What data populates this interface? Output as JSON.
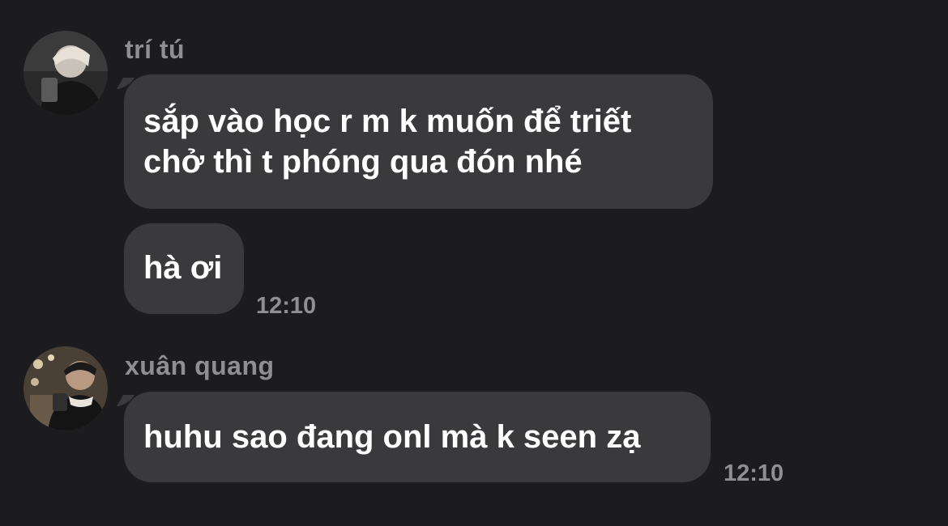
{
  "messages": [
    {
      "sender": "trí tú",
      "bubbles": [
        {
          "lines": [
            "sắp vào học r m k muốn để triết",
            "chở thì t phóng qua đón nhé"
          ]
        },
        {
          "lines": [
            "hà ơi"
          ],
          "time": "12:10"
        }
      ]
    },
    {
      "sender": "xuân quang",
      "bubbles": [
        {
          "lines": [
            "huhu sao đang onl mà k seen zạ"
          ],
          "time": "12:10"
        }
      ]
    }
  ],
  "colors": {
    "background": "#1c1c1e",
    "bubble": "#3a3a3c",
    "text": "#ffffff",
    "meta": "#8e8e93"
  }
}
